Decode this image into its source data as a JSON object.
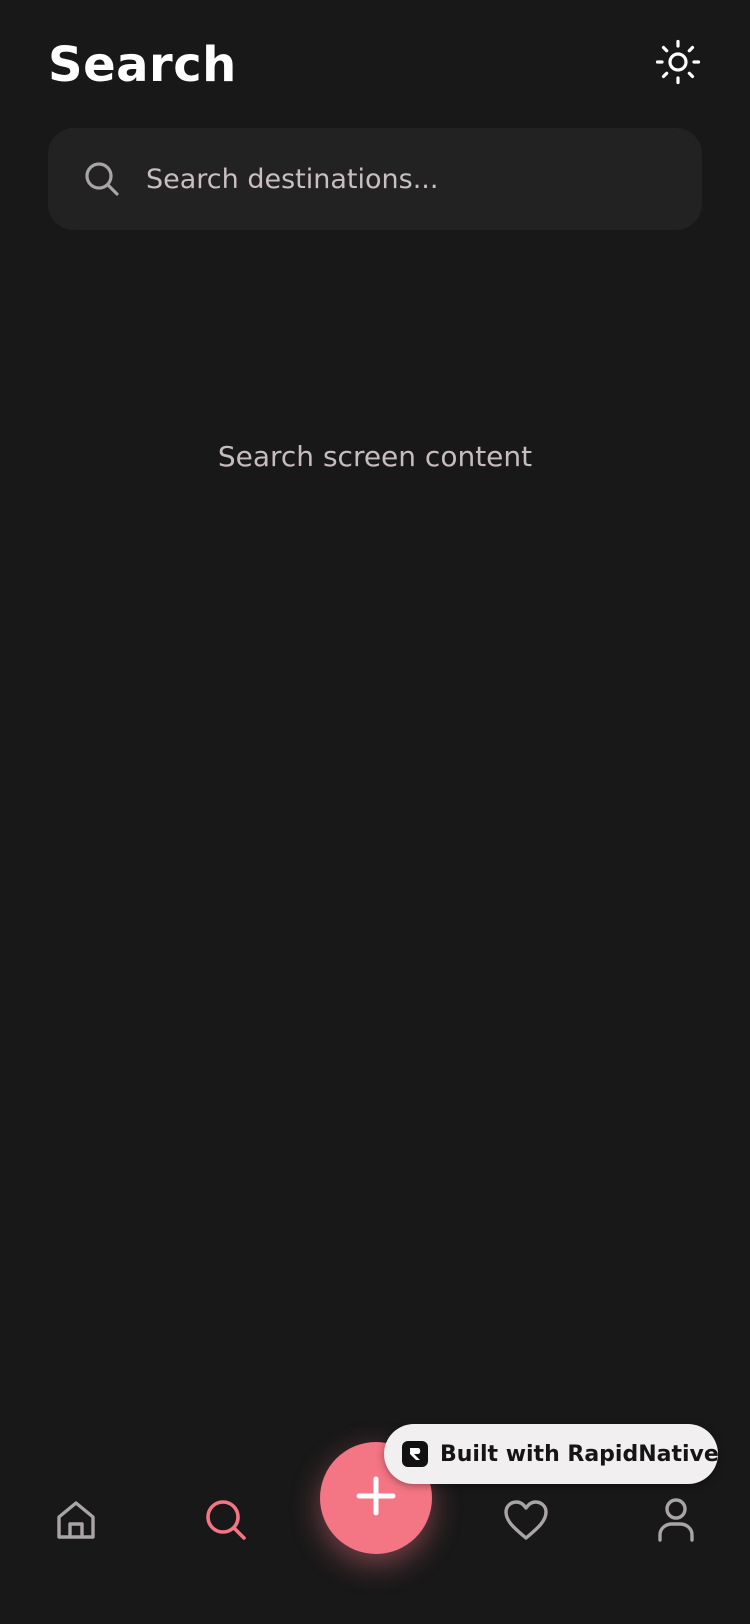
{
  "header": {
    "title": "Search",
    "theme_icon": "sun-icon"
  },
  "search": {
    "placeholder": "Search destinations...",
    "value": "",
    "icon": "search-icon"
  },
  "main": {
    "content_text": "Search screen content"
  },
  "tab_bar": {
    "items": [
      {
        "name": "home",
        "icon": "home-icon",
        "active": false
      },
      {
        "name": "search",
        "icon": "search-icon",
        "active": true
      },
      {
        "name": "add",
        "icon": "plus-icon",
        "active": false
      },
      {
        "name": "favorites",
        "icon": "heart-icon",
        "active": false
      },
      {
        "name": "profile",
        "icon": "user-icon",
        "active": false
      }
    ]
  },
  "badge": {
    "label": "Built with RapidNative",
    "logo_icon": "rapidnative-logo-icon"
  },
  "colors": {
    "background": "#181818",
    "surface": "#222222",
    "accent": "#f47584",
    "text_primary": "#ffffff",
    "text_muted": "#c6bcc0",
    "icon_inactive": "#a9a4a6",
    "badge_background": "#f1eff0"
  }
}
